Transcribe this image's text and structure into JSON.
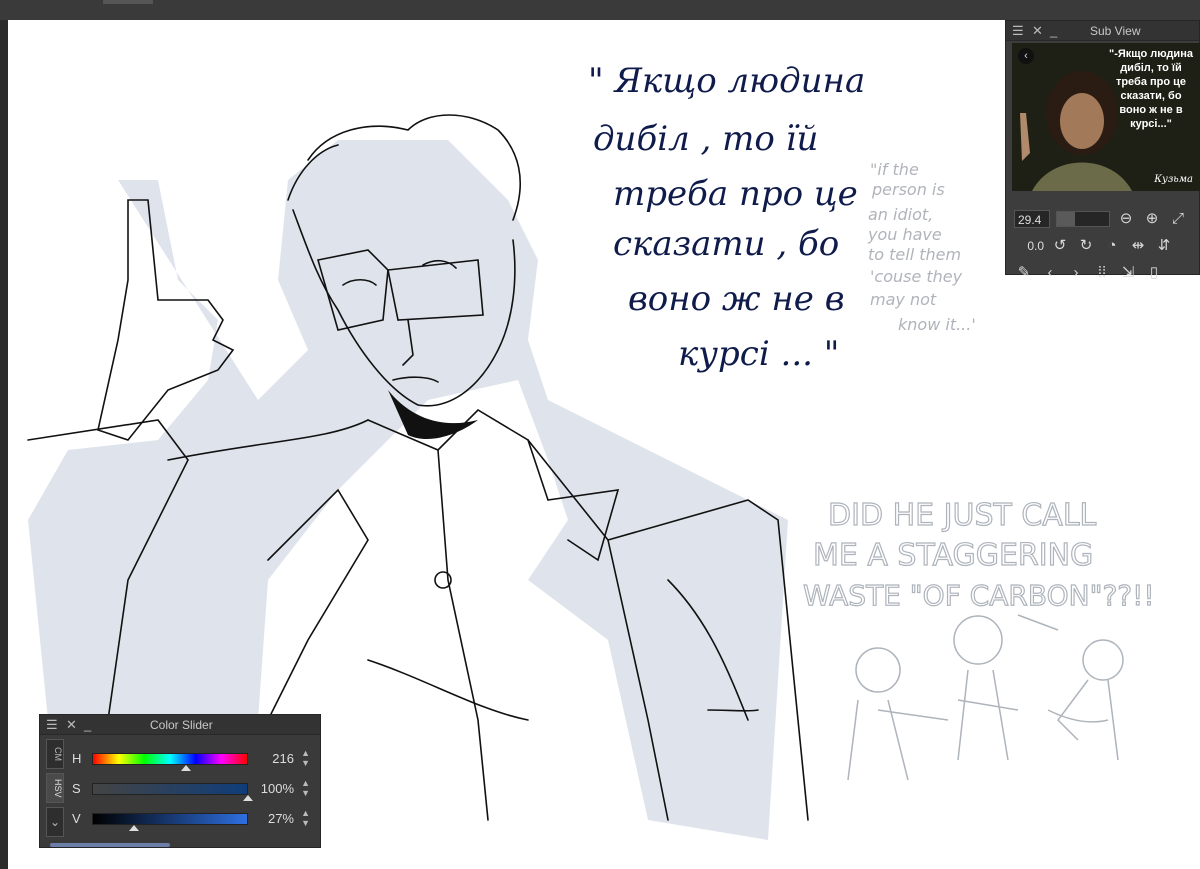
{
  "canvas": {
    "ua_lines": [
      "\" Якщо людина",
      "дибіл , то їй",
      "треба про це",
      "сказати , бо",
      "воно ж не в",
      "курсі ... \""
    ],
    "en_lines": [
      "\"if the",
      "person is",
      "an idiot,",
      "you have",
      "to tell them",
      "'couse they",
      "may not",
      "know it...'"
    ],
    "caps_lines": [
      "DID HE JUST CALL",
      "ME A STAGGERING",
      "WASTE \"OF CARBON\"??!!"
    ]
  },
  "subview": {
    "title": "Sub View",
    "thumb_quote": "\"-Якщо людина дибіл, то їй треба про це сказати, бо воно ж не в курсі...\"",
    "thumb_signature": "Кузьма",
    "zoom_value": "29.4",
    "zoom_fraction": 0.35,
    "rotation_value": "0.0",
    "icons": [
      "zoom-out-icon",
      "zoom-in-icon",
      "rotate-left-icon",
      "rotate-right-icon",
      "reset-rotation-icon",
      "flip-horizontal-icon",
      "eyedropper-icon",
      "previous-icon",
      "next-icon",
      "grid-icon",
      "import-icon",
      "delete-icon"
    ]
  },
  "color_slider": {
    "title": "Color Slider",
    "tabs": [
      "CM",
      "HSV"
    ],
    "rows": [
      {
        "label": "H",
        "value": "216",
        "fraction": 0.6
      },
      {
        "label": "S",
        "value": "100%",
        "fraction": 1.0
      },
      {
        "label": "V",
        "value": "27%",
        "fraction": 0.27
      }
    ],
    "accent": "#0f3d7a"
  }
}
